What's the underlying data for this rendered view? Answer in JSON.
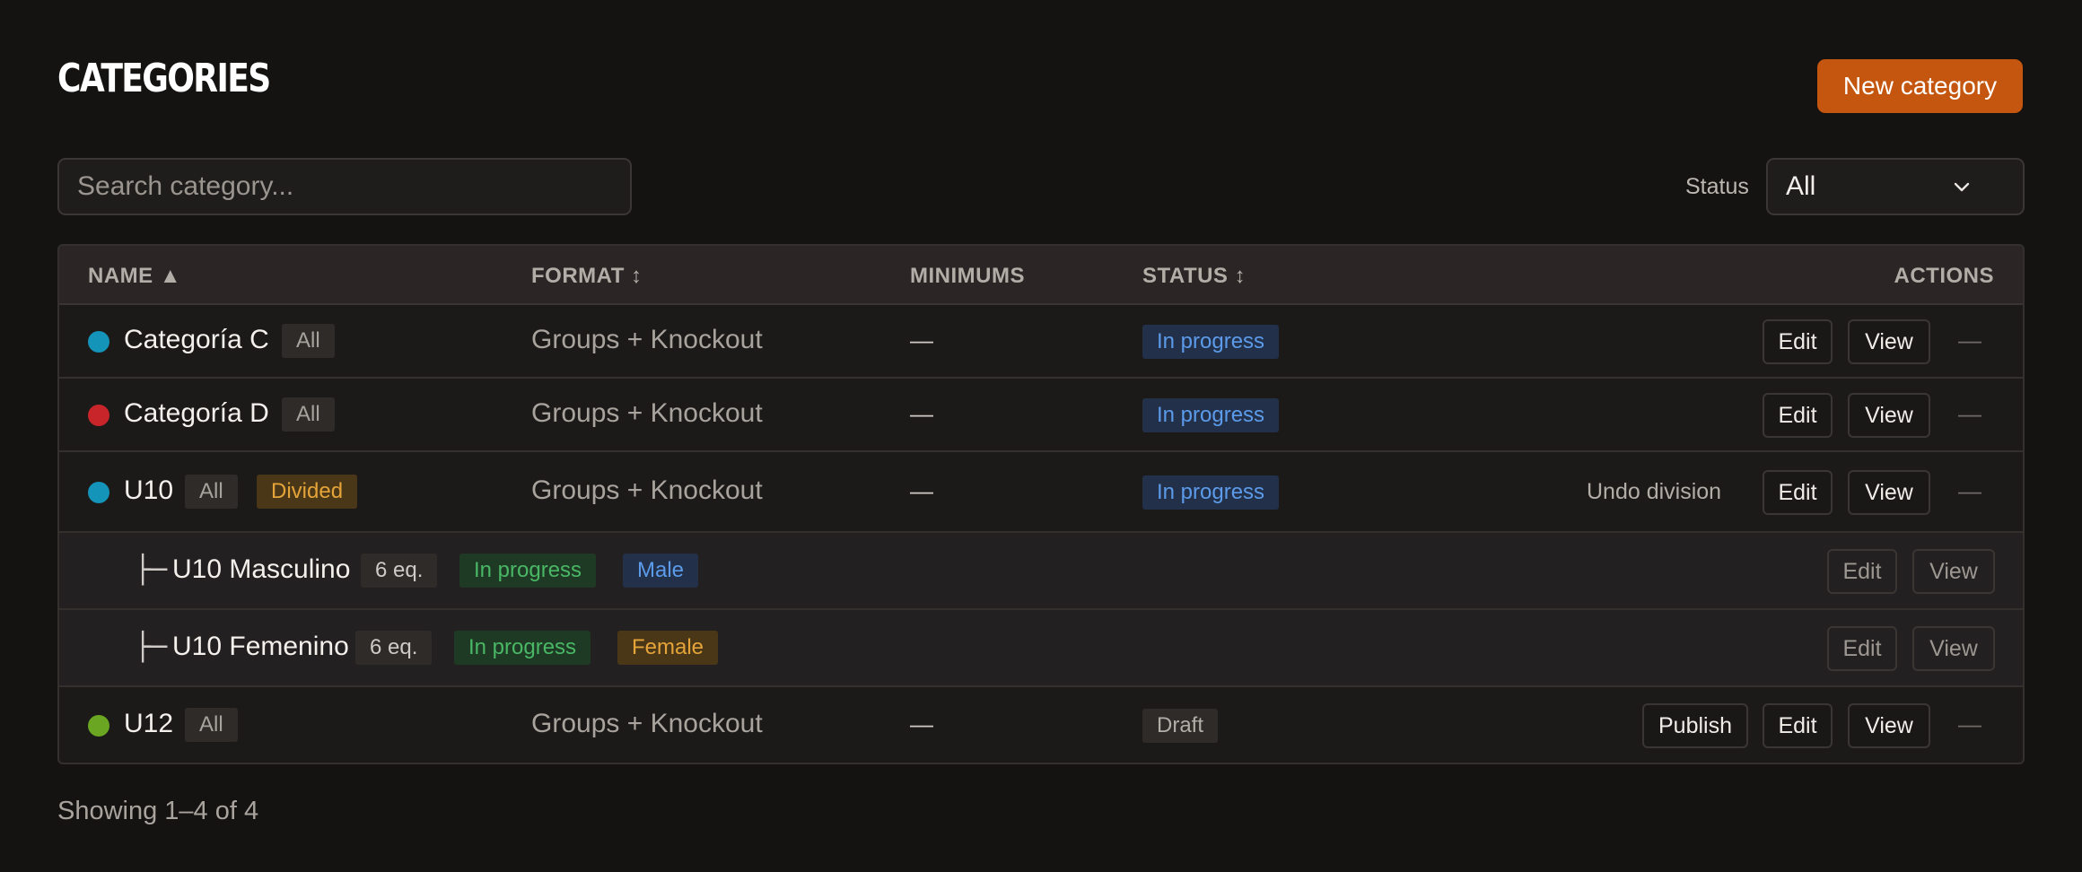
{
  "header": {
    "title": "CATEGORIES",
    "new_button": "New category"
  },
  "filters": {
    "search_placeholder": "Search category...",
    "status_label": "Status",
    "status_value": "All"
  },
  "table": {
    "columns": {
      "name": "NAME ▲",
      "format": "FORMAT ↕",
      "minimums": "MINIMUMS",
      "status": "STATUS ↕",
      "actions": "ACTIONS"
    },
    "rows": [
      {
        "dot_color": "#1494b8",
        "name": "Categoría C",
        "tag": "All",
        "format": "Groups + Knockout",
        "minimums": "—",
        "status": "In progress",
        "edit": "Edit",
        "view": "View",
        "more": "—"
      },
      {
        "dot_color": "#c8252b",
        "name": "Categoría D",
        "tag": "All",
        "format": "Groups + Knockout",
        "minimums": "—",
        "status": "In progress",
        "edit": "Edit",
        "view": "View",
        "more": "—"
      },
      {
        "dot_color": "#1494b8",
        "name": "U10",
        "tag": "All",
        "tag2": "Divided",
        "format": "Groups + Knockout",
        "minimums": "—",
        "status": "In progress",
        "undo": "Undo division",
        "edit": "Edit",
        "view": "View",
        "more": "—"
      },
      {
        "tree": "├─",
        "name": "U10 Masculino",
        "teams": "6 eq.",
        "status": "In progress",
        "gender": "Male",
        "edit": "Edit",
        "view": "View"
      },
      {
        "tree": "├─",
        "name": "U10 Femenino",
        "teams": "6 eq.",
        "status": "In progress",
        "gender": "Female",
        "edit": "Edit",
        "view": "View"
      },
      {
        "dot_color": "#6aa621",
        "name": "U12",
        "tag": "All",
        "format": "Groups + Knockout",
        "minimums": "—",
        "status": "Draft",
        "publish": "Publish",
        "edit": "Edit",
        "view": "View",
        "more": "—"
      }
    ]
  },
  "footer": {
    "showing": "Showing 1–4 of 4"
  }
}
